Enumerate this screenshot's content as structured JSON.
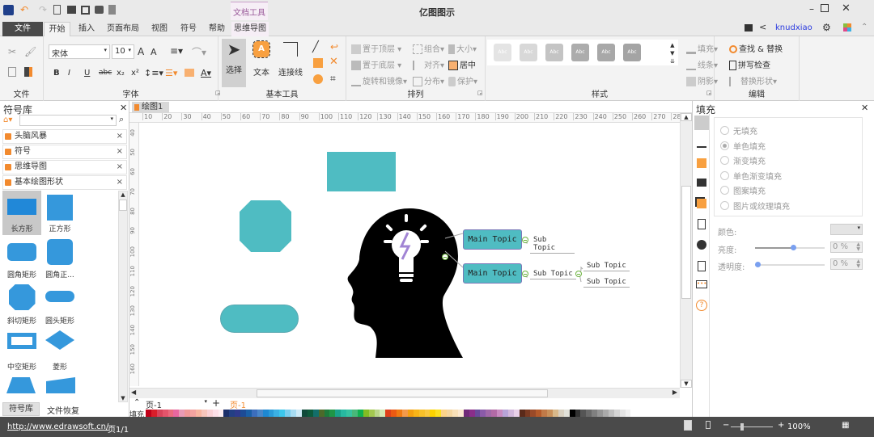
{
  "app": {
    "title": "亿图图示",
    "context_tab": "文档工具",
    "user": "knudxiao"
  },
  "tabs": [
    "文件",
    "开始",
    "插入",
    "页面布局",
    "视图",
    "符号",
    "帮助",
    "思维导图"
  ],
  "ribbon": {
    "groups": [
      "文件",
      "字体",
      "基本工具",
      "排列",
      "样式",
      "编辑"
    ],
    "font_name": "宋体",
    "font_size": "10",
    "tools": {
      "select": "选择",
      "text": "文本",
      "connector": "连接线"
    },
    "arrange": [
      "置于顶层",
      "置于底层",
      "旋转和镜像",
      "组合",
      "对齐",
      "分布",
      "大小",
      "居中",
      "保护"
    ],
    "style_swatch": "Abc",
    "fill": "填充",
    "line": "线条",
    "shadow": "阴影",
    "edit": [
      "查找 & 替换",
      "拼写检查",
      "替换形状"
    ]
  },
  "left_panel": {
    "title": "符号库",
    "search_placeholder": "",
    "categories": [
      "头脑风暴",
      "符号",
      "思维导图",
      "基本绘图形状"
    ],
    "shapes": [
      "长方形",
      "正方形",
      "圆角矩形",
      "圆角正...",
      "斜切矩形",
      "圆头矩形",
      "中空矩形",
      "菱形"
    ],
    "bottom_tabs": [
      "符号库",
      "文件恢复"
    ]
  },
  "document": {
    "tab": "绘图1",
    "ruler_h": [
      "10",
      "20",
      "30",
      "40",
      "50",
      "60",
      "70",
      "80",
      "90",
      "100",
      "110",
      "120",
      "130",
      "140",
      "150",
      "160",
      "170",
      "180",
      "190",
      "200",
      "210",
      "220",
      "230",
      "240",
      "250",
      "260",
      "270",
      "280"
    ],
    "ruler_v": [
      "40",
      "50",
      "60",
      "70",
      "80",
      "90",
      "100",
      "110",
      "120",
      "130",
      "140",
      "150",
      "160"
    ],
    "main_topics": [
      "Main Topic",
      "Main Topic"
    ],
    "sub_topics": [
      "Sub Topic",
      "Sub Topic",
      "Sub Topic",
      "Sub Topic"
    ],
    "page_select": "页-1",
    "page_tab": "页-1",
    "palette_label": "填充",
    "shape_color": "#4fbcc2"
  },
  "palette": [
    "#c00018",
    "#d81e2a",
    "#d9435a",
    "#e5546b",
    "#ea6a7d",
    "#e8679f",
    "#e99ab5",
    "#f09898",
    "#f4a3a0",
    "#f8b5a0",
    "#f8c6bc",
    "#fad2d6",
    "#fde0e8",
    "#fdeef2",
    "#1c2f6a",
    "#233f84",
    "#2e3a8c",
    "#1d4b96",
    "#1a5fa6",
    "#3c6ebc",
    "#4a86c8",
    "#1e88d2",
    "#2a9bd8",
    "#3bb0e4",
    "#3cc6ec",
    "#79cdee",
    "#a7dcf2",
    "#cfeaf6",
    "#0f4a3a",
    "#0d5a3a",
    "#136e6a",
    "#4c6a2a",
    "#1e7a3c",
    "#1f9646",
    "#1aa38a",
    "#27b8a0",
    "#37c2a0",
    "#48b87a",
    "#10b050",
    "#82bc24",
    "#a3c850",
    "#bad68a",
    "#d6e8b4",
    "#e0401a",
    "#ec5a12",
    "#f07a12",
    "#f49a4a",
    "#f4a010",
    "#f8b418",
    "#f8c02a",
    "#fac840",
    "#fcd200",
    "#fce020",
    "#fcd48a",
    "#f4d6a0",
    "#f8e0b8",
    "#fbe8d0",
    "#702a78",
    "#8a2e8a",
    "#6a4a9a",
    "#8a5aa8",
    "#a068a8",
    "#b26aa6",
    "#c88ac0",
    "#b8a4d8",
    "#d2b8dc",
    "#e8d0e8",
    "#5a2a1a",
    "#7a3a22",
    "#9a4a28",
    "#b45a2a",
    "#c07a48",
    "#c8905a",
    "#d8b88a",
    "#d8d0c0",
    "#e0e0d8",
    "#000000",
    "#333333",
    "#555555",
    "#6a6a6a",
    "#808080",
    "#959595",
    "#aaaaaa",
    "#bfbfbf",
    "#d4d4d4",
    "#e4e4e4",
    "#f0f0f0"
  ],
  "right_panel": {
    "title": "填充",
    "options": [
      "无填充",
      "单色填充",
      "渐变填充",
      "单色渐变填充",
      "图案填充",
      "图片或纹理填充"
    ],
    "selected": "单色填充",
    "color_label": "颜色:",
    "brightness_label": "亮度:",
    "brightness_value": "0 %",
    "brightness_level": 0.55,
    "transparency_label": "透明度:",
    "transparency_value": "0 %",
    "transparency_level": 0
  },
  "status": {
    "url": "http://www.edrawsoft.cn/",
    "page": "页1/1",
    "zoom": "100%"
  }
}
